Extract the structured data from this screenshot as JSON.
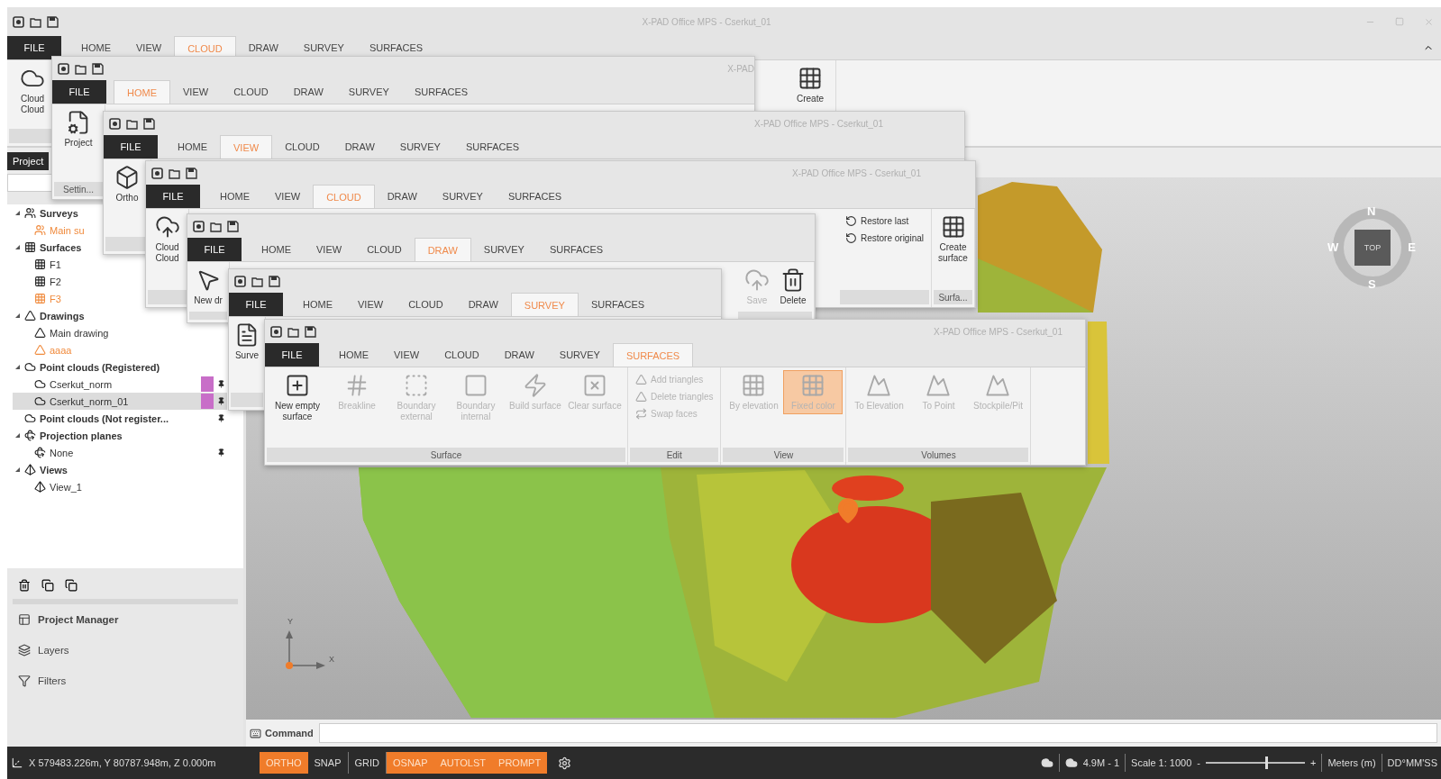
{
  "base": {
    "title": "X-PAD Office MPS - Cserkut_01",
    "tabs": [
      {
        "label": "FILE",
        "kind": "file",
        "selected": false
      },
      {
        "label": "HOME",
        "kind": "tab",
        "selected": false
      },
      {
        "label": "VIEW",
        "kind": "tab",
        "selected": false
      },
      {
        "label": "CLOUD",
        "kind": "tab",
        "selected": true
      },
      {
        "label": "DRAW",
        "kind": "tab",
        "selected": false
      },
      {
        "label": "SURVEY",
        "kind": "tab",
        "selected": false
      },
      {
        "label": "SURFACES",
        "kind": "tab",
        "selected": false
      }
    ],
    "left_groups": [
      {
        "items": [
          {
            "kind": "large",
            "label": "Cloud Cloud",
            "disabled": false,
            "selected": false
          }
        ]
      }
    ],
    "right_groups": [
      {
        "items": [
          {
            "kind": "large",
            "label": "Create",
            "disabled": false,
            "selected": false
          }
        ]
      }
    ]
  },
  "windows": [
    {
      "title": "X-PAD",
      "tabs": [
        {
          "label": "FILE",
          "kind": "file",
          "selected": false
        },
        {
          "label": "HOME",
          "kind": "tab",
          "selected": true
        },
        {
          "label": "VIEW",
          "kind": "tab",
          "selected": false
        },
        {
          "label": "CLOUD",
          "kind": "tab",
          "selected": false
        },
        {
          "label": "DRAW",
          "kind": "tab",
          "selected": false
        },
        {
          "label": "SURVEY",
          "kind": "tab",
          "selected": false
        },
        {
          "label": "SURFACES",
          "kind": "tab",
          "selected": false
        }
      ],
      "left_groups": [
        {
          "label": "Settin...",
          "items": [
            {
              "kind": "large",
              "label": "Project",
              "disabled": false,
              "selected": false
            }
          ]
        }
      ]
    },
    {
      "title": "X-PAD Office MPS - Cserkut_01",
      "tabs": [
        {
          "label": "FILE",
          "kind": "file",
          "selected": false
        },
        {
          "label": "HOME",
          "kind": "tab",
          "selected": false
        },
        {
          "label": "VIEW",
          "kind": "tab",
          "selected": true
        },
        {
          "label": "CLOUD",
          "kind": "tab",
          "selected": false
        },
        {
          "label": "DRAW",
          "kind": "tab",
          "selected": false
        },
        {
          "label": "SURVEY",
          "kind": "tab",
          "selected": false
        },
        {
          "label": "SURFACES",
          "kind": "tab",
          "selected": false
        }
      ],
      "left_groups": [
        {
          "items": [
            {
              "kind": "large",
              "label": "Ortho",
              "disabled": false,
              "selected": false
            }
          ]
        }
      ]
    },
    {
      "title": "X-PAD Office MPS - Cserkut_01",
      "tabs": [
        {
          "label": "FILE",
          "kind": "file",
          "selected": false
        },
        {
          "label": "HOME",
          "kind": "tab",
          "selected": false
        },
        {
          "label": "VIEW",
          "kind": "tab",
          "selected": false
        },
        {
          "label": "CLOUD",
          "kind": "tab",
          "selected": true
        },
        {
          "label": "DRAW",
          "kind": "tab",
          "selected": false
        },
        {
          "label": "SURVEY",
          "kind": "tab",
          "selected": false
        },
        {
          "label": "SURFACES",
          "kind": "tab",
          "selected": false
        }
      ],
      "left_groups": [
        {
          "items": [
            {
              "kind": "large",
              "label": "Cloud Cloud",
              "disabled": false,
              "selected": false
            }
          ]
        }
      ],
      "right_groups": [
        {
          "items": [
            {
              "kind": "small",
              "label": "Restore last",
              "disabled": false,
              "selected": false
            },
            {
              "kind": "small",
              "label": "Restore original",
              "disabled": false,
              "selected": false
            }
          ]
        },
        {
          "label": "Surfa...",
          "items": [
            {
              "kind": "large",
              "label": "Create surface",
              "disabled": false,
              "selected": false
            }
          ]
        }
      ]
    },
    {
      "tabs": [
        {
          "label": "FILE",
          "kind": "file",
          "selected": false
        },
        {
          "label": "HOME",
          "kind": "tab",
          "selected": false
        },
        {
          "label": "VIEW",
          "kind": "tab",
          "selected": false
        },
        {
          "label": "CLOUD",
          "kind": "tab",
          "selected": false
        },
        {
          "label": "DRAW",
          "kind": "tab",
          "selected": true
        },
        {
          "label": "SURVEY",
          "kind": "tab",
          "selected": false
        },
        {
          "label": "SURFACES",
          "kind": "tab",
          "selected": false
        }
      ],
      "left_groups": [
        {
          "items": [
            {
              "kind": "large",
              "label": "New dr",
              "disabled": false,
              "selected": false
            }
          ]
        }
      ],
      "right_groups": [
        {
          "items": [
            {
              "kind": "large",
              "label": "Save",
              "disabled": true,
              "selected": false
            },
            {
              "kind": "large",
              "label": "Delete",
              "disabled": false,
              "selected": false
            }
          ]
        }
      ]
    },
    {
      "tabs": [
        {
          "label": "FILE",
          "kind": "file",
          "selected": false
        },
        {
          "label": "HOME",
          "kind": "tab",
          "selected": false
        },
        {
          "label": "VIEW",
          "kind": "tab",
          "selected": false
        },
        {
          "label": "CLOUD",
          "kind": "tab",
          "selected": false
        },
        {
          "label": "DRAW",
          "kind": "tab",
          "selected": false
        },
        {
          "label": "SURVEY",
          "kind": "tab",
          "selected": true
        },
        {
          "label": "SURFACES",
          "kind": "tab",
          "selected": false
        }
      ],
      "left_groups": [
        {
          "items": [
            {
              "kind": "large",
              "label": "Surve",
              "disabled": false,
              "selected": false
            }
          ]
        }
      ]
    },
    {
      "title": "X-PAD Office MPS - Cserkut_01",
      "tabs": [
        {
          "label": "FILE",
          "kind": "file",
          "selected": false
        },
        {
          "label": "HOME",
          "kind": "tab",
          "selected": false
        },
        {
          "label": "VIEW",
          "kind": "tab",
          "selected": false
        },
        {
          "label": "CLOUD",
          "kind": "tab",
          "selected": false
        },
        {
          "label": "DRAW",
          "kind": "tab",
          "selected": false
        },
        {
          "label": "SURVEY",
          "kind": "tab",
          "selected": false
        },
        {
          "label": "SURFACES",
          "kind": "tab",
          "selected": true
        }
      ],
      "left_groups": [
        {
          "label": "Surface",
          "items": [
            {
              "kind": "large",
              "label": "New empty surface",
              "disabled": false,
              "selected": false
            },
            {
              "kind": "large",
              "label": "Breakline",
              "disabled": true,
              "selected": false
            },
            {
              "kind": "large",
              "label": "Boundary external",
              "disabled": true,
              "selected": false
            },
            {
              "kind": "large",
              "label": "Boundary internal",
              "disabled": true,
              "selected": false
            },
            {
              "kind": "large",
              "label": "Build surface",
              "disabled": true,
              "selected": false
            },
            {
              "kind": "large",
              "label": "Clear surface",
              "disabled": true,
              "selected": false
            }
          ]
        },
        {
          "label": "Edit",
          "items": [
            {
              "kind": "small",
              "label": "Add triangles",
              "disabled": true,
              "selected": false
            },
            {
              "kind": "small",
              "label": "Delete triangles",
              "disabled": true,
              "selected": false
            },
            {
              "kind": "small",
              "label": "Swap faces",
              "disabled": true,
              "selected": false
            }
          ]
        },
        {
          "label": "View",
          "items": [
            {
              "kind": "large",
              "label": "By elevation",
              "disabled": true,
              "selected": false
            },
            {
              "kind": "large",
              "label": "Fixed color",
              "disabled": true,
              "selected": true
            }
          ]
        },
        {
          "label": "Volumes",
          "items": [
            {
              "kind": "large",
              "label": "To Elevation",
              "disabled": true,
              "selected": false
            },
            {
              "kind": "large",
              "label": "To Point",
              "disabled": true,
              "selected": false
            },
            {
              "kind": "large",
              "label": "Stockpile/Pit",
              "disabled": true,
              "selected": false
            }
          ]
        }
      ]
    }
  ],
  "sidebar": {
    "tab": "Project",
    "tree": [
      {
        "label": "Surveys",
        "expanded": true,
        "selected": false,
        "current": false,
        "children": [
          {
            "label": "Main su",
            "selected": false,
            "current": true
          }
        ]
      },
      {
        "label": "Surfaces",
        "expanded": true,
        "selected": false,
        "current": false,
        "children": [
          {
            "label": "F1",
            "selected": false,
            "current": false
          },
          {
            "label": "F2",
            "selected": false,
            "current": false
          },
          {
            "label": "F3",
            "selected": false,
            "current": true
          }
        ]
      },
      {
        "label": "Drawings",
        "expanded": true,
        "selected": false,
        "current": false,
        "children": [
          {
            "label": "Main drawing",
            "selected": false,
            "current": false
          },
          {
            "label": "aaaa",
            "selected": false,
            "current": true
          }
        ]
      },
      {
        "label": "Point clouds (Registered)",
        "expanded": true,
        "selected": false,
        "current": false,
        "children": [
          {
            "label": "Cserkut_norm",
            "selected": false,
            "current": false,
            "color": "#c86ec8",
            "pin": true
          },
          {
            "label": "Cserkut_norm_01",
            "selected": true,
            "current": false,
            "color": "#c86ec8",
            "pin": true
          }
        ]
      },
      {
        "label": "Point clouds (Not register...",
        "selected": false,
        "current": false,
        "pin": true
      },
      {
        "label": "Projection planes",
        "expanded": true,
        "selected": false,
        "current": false,
        "children": [
          {
            "label": "None",
            "selected": false,
            "current": false,
            "pin": true
          }
        ]
      },
      {
        "label": "Views",
        "expanded": true,
        "selected": false,
        "current": false,
        "children": [
          {
            "label": "View_1",
            "selected": false,
            "current": false
          }
        ]
      }
    ],
    "panels": [
      {
        "label": "Project Manager",
        "selected": true
      },
      {
        "label": "Layers",
        "selected": false
      },
      {
        "label": "Filters",
        "selected": false
      }
    ]
  },
  "viewport": {
    "compass": {
      "north": "N",
      "east": "E",
      "south": "S",
      "west": "W",
      "center": "TOP"
    },
    "axes": {
      "x": "X",
      "y": "Y"
    }
  },
  "command": {
    "label": "Command"
  },
  "status": {
    "coordinates": "X 579483.226m, Y 80787.948m, Z 0.000m",
    "toggles": [
      {
        "label": "ORTHO",
        "on": true
      },
      {
        "label": "SNAP",
        "on": false
      },
      {
        "label": "GRID",
        "on": false
      },
      {
        "label": "OSNAP",
        "on": true
      },
      {
        "label": "AUTOLST",
        "on": true
      },
      {
        "label": "PROMPT",
        "on": true
      }
    ],
    "cloud_count": "4.9M - 1",
    "scale": "Scale 1: 1000",
    "zoom_minus": "-",
    "zoom_plus": "+",
    "zoom": {
      "level": 0.6
    },
    "units": "Meters (m)",
    "angle": "DD°MM'SS"
  }
}
